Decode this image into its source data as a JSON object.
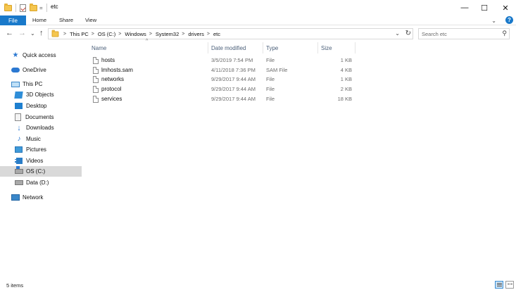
{
  "window": {
    "title": "etc",
    "minimize_glyph": "—",
    "maximize_glyph": "☐",
    "close_glyph": "✕",
    "qa_dropdown_glyph": "="
  },
  "ribbon": {
    "tabs": [
      "File",
      "Home",
      "Share",
      "View"
    ],
    "expand_glyph": "⌄",
    "help_glyph": "?"
  },
  "nav": {
    "back_glyph": "←",
    "forward_glyph": "→",
    "recent_glyph": "⌄",
    "up_glyph": "↑"
  },
  "address": {
    "crumbs": [
      "This PC",
      "OS (C:)",
      "Windows",
      "System32",
      "drivers",
      "etc"
    ],
    "separator": ">",
    "dropdown_glyph": "⌄",
    "refresh_glyph": "↻"
  },
  "search": {
    "placeholder": "Search etc",
    "icon_glyph": "⚲"
  },
  "sidebar": {
    "quick_access": "Quick access",
    "onedrive": "OneDrive",
    "this_pc": "This PC",
    "items": [
      "3D Objects",
      "Desktop",
      "Documents",
      "Downloads",
      "Music",
      "Pictures",
      "Videos",
      "OS (C:)",
      "Data (D:)"
    ],
    "network": "Network",
    "selected": "OS (C:)"
  },
  "columns": {
    "name": "Name",
    "date": "Date modified",
    "type": "Type",
    "size": "Size",
    "sort_glyph": "^"
  },
  "files": [
    {
      "name": "hosts",
      "date": "3/5/2019 7:54 PM",
      "type": "File",
      "size": "1 KB"
    },
    {
      "name": "lmhosts.sam",
      "date": "4/11/2018 7:36 PM",
      "type": "SAM File",
      "size": "4 KB"
    },
    {
      "name": "networks",
      "date": "9/29/2017 9:44 AM",
      "type": "File",
      "size": "1 KB"
    },
    {
      "name": "protocol",
      "date": "9/29/2017 9:44 AM",
      "type": "File",
      "size": "2 KB"
    },
    {
      "name": "services",
      "date": "9/29/2017 9:44 AM",
      "type": "File",
      "size": "18 KB"
    }
  ],
  "status": {
    "count": "5 items"
  },
  "colors": {
    "accent": "#1979ca",
    "selection": "#d9d9d9"
  }
}
